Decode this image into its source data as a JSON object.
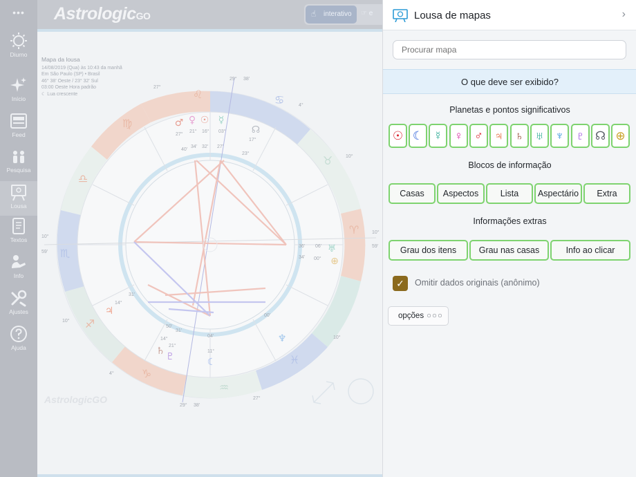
{
  "app": {
    "logo": "Astrologic",
    "logo_suffix": "GO",
    "more_label": "•••"
  },
  "sidebar": {
    "items": [
      {
        "label": "Diurno",
        "icon": "sun-icon"
      },
      {
        "label": "Início",
        "icon": "sparkle-icon"
      },
      {
        "label": "Feed",
        "icon": "newspaper-icon"
      },
      {
        "label": "Pesquisa",
        "icon": "people-icon"
      },
      {
        "label": "Lousa",
        "icon": "easel-icon",
        "active": true
      },
      {
        "label": "Textos",
        "icon": "document-icon"
      },
      {
        "label": "Info",
        "icon": "person-reading-icon"
      },
      {
        "label": "Ajustes",
        "icon": "wrench-icon"
      },
      {
        "label": "Ajuda",
        "icon": "help-icon"
      }
    ]
  },
  "topbar": {
    "mode_active": "interativo",
    "mode_other": "e"
  },
  "chart": {
    "meta_title": "Mapa da lousa",
    "meta_lines": [
      "14/08/2019 (Qua) às 10:43 da manhã",
      "Em São Paulo (SP) • Brasil",
      "46° 38' Oeste / 23° 32' Sul",
      "03:00 Oeste Hora padrão",
      "☾ Lua crescente"
    ],
    "watermark": "AstrologicGO",
    "labels": {
      "top_deg": "29°",
      "top_min": "38'",
      "bottom_deg": "29°",
      "bottom_min": "38'",
      "left_deg": "10°",
      "left_min": "59'",
      "right_deg": "10°",
      "right_min": "59'",
      "tl_deg": "27°",
      "tr_deg": "4°",
      "r_upper_deg": "10°",
      "r_lower_deg": "10°",
      "bl_deg": "4°",
      "br_deg": "27°",
      "ll_deg": "10°",
      "p_27": "27°",
      "p_21": "21°",
      "p_16": "16°",
      "p_03": "03°",
      "p_17": "17°",
      "p_23": "23°",
      "p_40": "40'",
      "p_34": "34'",
      "p_32": "32'",
      "p_27b": "27'",
      "p_36": "36'",
      "p_06": "06'",
      "p_34b": "34'",
      "p_00": "00°",
      "p_14": "14°",
      "p_31": "31'",
      "p_50": "50'",
      "p_31b": "31'",
      "p_14b": "14°",
      "p_21b": "21°",
      "p_04": "04'",
      "p_11": "11°",
      "p_00b": "00'"
    }
  },
  "panel": {
    "title": "Lousa de mapas",
    "search_placeholder": "Procurar mapa",
    "question": "O que deve ser exibido?",
    "section_planets": "Planetas e pontos significativos",
    "planets": [
      {
        "symbol": "☉",
        "name": "sun-icon",
        "color": "#d9232e"
      },
      {
        "symbol": "☾",
        "name": "moon-icon",
        "color": "#2b5fd9"
      },
      {
        "symbol": "☿",
        "name": "mercury-icon",
        "color": "#1ea58d"
      },
      {
        "symbol": "♀",
        "name": "venus-icon",
        "color": "#d930a7"
      },
      {
        "symbol": "♂",
        "name": "mars-icon",
        "color": "#d9232e"
      },
      {
        "symbol": "♃",
        "name": "jupiter-icon",
        "color": "#e04e1a"
      },
      {
        "symbol": "♄",
        "name": "saturn-icon",
        "color": "#8b3a25"
      },
      {
        "symbol": "♅",
        "name": "uranus-icon",
        "color": "#1ea58d"
      },
      {
        "symbol": "♆",
        "name": "neptune-icon",
        "color": "#2b8fd9"
      },
      {
        "symbol": "♇",
        "name": "pluto-icon",
        "color": "#8a2bd9"
      },
      {
        "symbol": "☊",
        "name": "node-icon",
        "color": "#5a5f68"
      },
      {
        "symbol": "⊕",
        "name": "fortune-icon",
        "color": "#c9a227"
      }
    ],
    "section_blocks": "Blocos de informação",
    "blocks": [
      "Casas",
      "Aspectos",
      "Lista",
      "Aspectário",
      "Extra"
    ],
    "section_extras": "Informações extras",
    "extras": [
      "Grau dos itens",
      "Grau nas casas",
      "Info ao clicar"
    ],
    "anonymous_label": "Omitir dados originais (anônimo)",
    "anonymous_checked": true,
    "options_label": "opções",
    "options_dots": "○○○"
  }
}
